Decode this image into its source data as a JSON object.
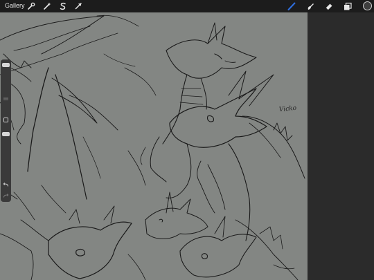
{
  "topbar": {
    "gallery_label": "Gallery",
    "left_tools": [
      {
        "name": "actions-wrench-icon"
      },
      {
        "name": "adjustments-wand-icon"
      },
      {
        "name": "selection-s-icon"
      },
      {
        "name": "transform-arrow-icon"
      }
    ],
    "right_tools": [
      {
        "name": "brush-icon",
        "active": true
      },
      {
        "name": "smudge-icon",
        "active": false
      },
      {
        "name": "eraser-icon",
        "active": false
      },
      {
        "name": "layers-icon",
        "active": false
      }
    ],
    "color_well": "#3f3f3f"
  },
  "sidebar": {
    "brush_size_level": 0.9,
    "opacity_level": 0.3,
    "undo_icon": "undo-icon",
    "redo_icon": "redo-icon"
  },
  "canvas": {
    "background": "#838683",
    "signature": "Vicko"
  },
  "colors": {
    "accent": "#2f6fe0",
    "topbar": "#1c1c1c",
    "panel": "#2b2b2b"
  }
}
